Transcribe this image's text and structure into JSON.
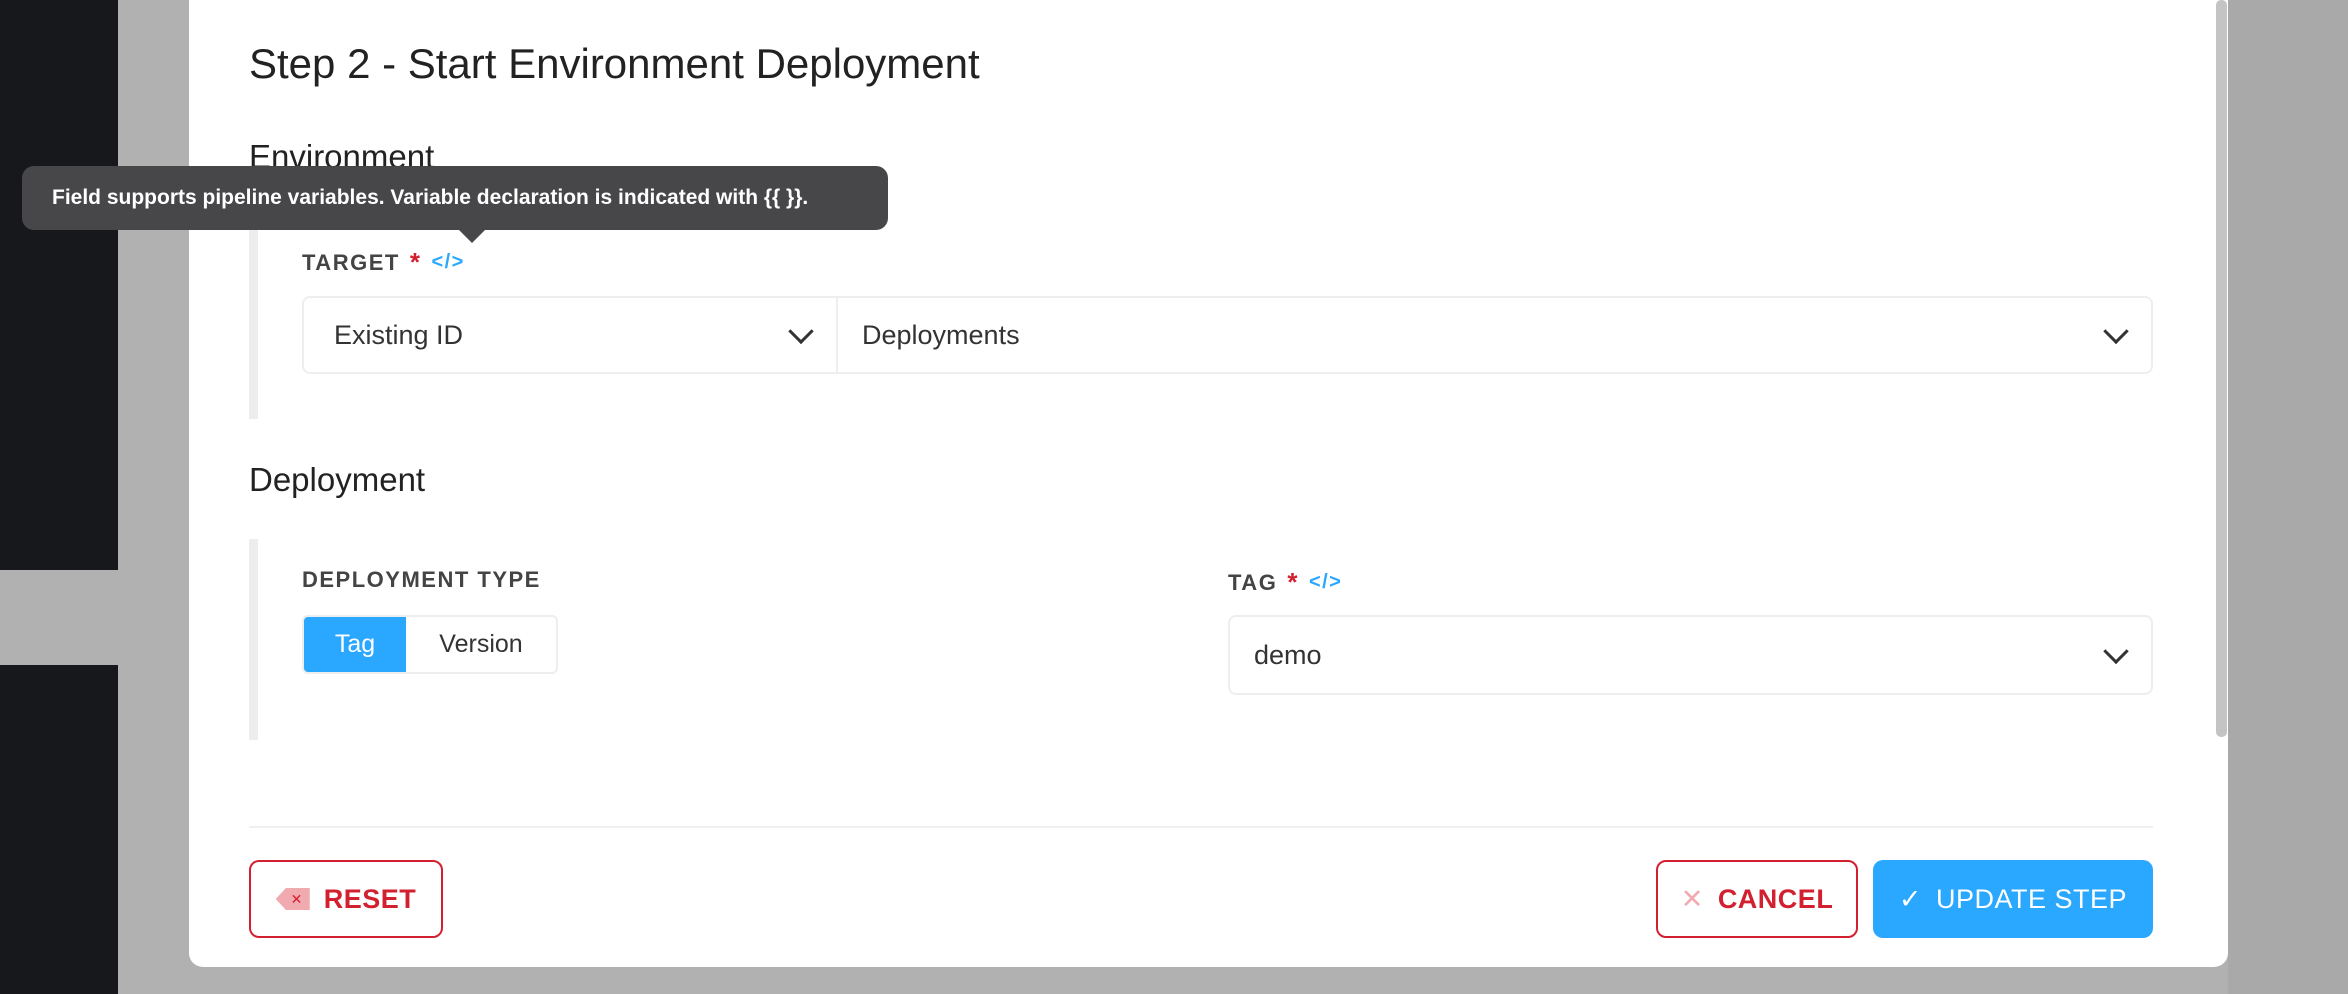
{
  "modal": {
    "title": "Step 2 - Start Environment Deployment",
    "environment_heading": "Environment",
    "target_label": "TARGET",
    "target_type": "Existing ID",
    "target_value": "Deployments",
    "deployment_heading": "Deployment",
    "deployment_type_label": "DEPLOYMENT TYPE",
    "deployment_type_options": [
      "Tag",
      "Version"
    ],
    "deployment_type_selected": "Tag",
    "tag_label": "TAG",
    "tag_value": "demo",
    "required_mark": "*",
    "variable_icon_glyph": "</>"
  },
  "tooltip": {
    "text": "Field supports pipeline variables. Variable declaration is indicated with {{ }}."
  },
  "footer": {
    "reset_label": "RESET",
    "cancel_label": "CANCEL",
    "update_label": "UPDATE STEP"
  },
  "colors": {
    "primary": "#2aa7ff",
    "danger": "#d32030",
    "tooltip_bg": "#47474a"
  }
}
